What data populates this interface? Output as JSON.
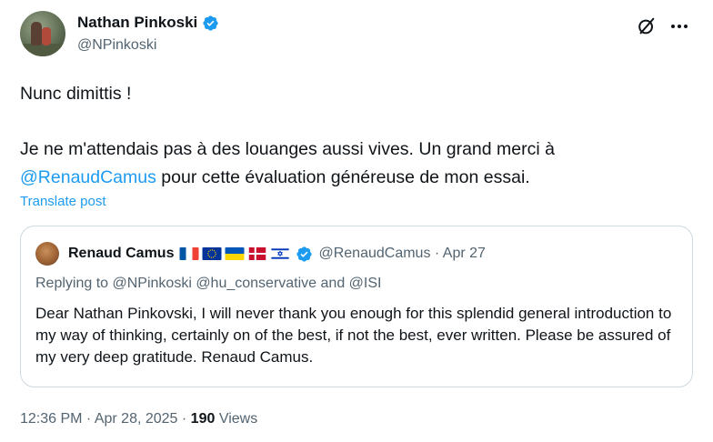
{
  "author": {
    "name": "Nathan Pinkoski",
    "handle": "@NPinkoski",
    "avatar_icon": "avatar-photo",
    "verified_icon": "verified-badge-icon"
  },
  "header_icons": [
    "grok-icon",
    "more-options-icon"
  ],
  "tweet": {
    "line1": "Nunc dimittis !",
    "line2_before": "Je ne m'attendais pas à des louanges aussi vives. Un grand merci à",
    "line2_mention": "@RenaudCamus",
    "line2_after": " pour cette évaluation généreuse de mon essai."
  },
  "translate_label": "Translate post",
  "quote": {
    "name": "Renaud Camus",
    "flags": [
      "flag-france",
      "flag-eu",
      "flag-ukraine",
      "flag-denmark",
      "flag-israel"
    ],
    "handle_date": "@RenaudCamus · Apr 27",
    "replying_to": "Replying to @NPinkoski @hu_conservative and @ISI",
    "text": "Dear Nathan Pinkovski, I will never thank you enough for this splendid general introduction to my way of thinking, certainly on of the best, if not the best, ever written. Please be assured of my very deep gratitude. Renaud Camus."
  },
  "meta": {
    "time_date": "12:36 PM · Apr 28, 2025 · ",
    "views_count": "190",
    "views_label": " Views"
  },
  "colors": {
    "accent": "#1d9bf0",
    "text": "#0f1419",
    "secondary": "#536471",
    "border": "#cfd9de"
  }
}
